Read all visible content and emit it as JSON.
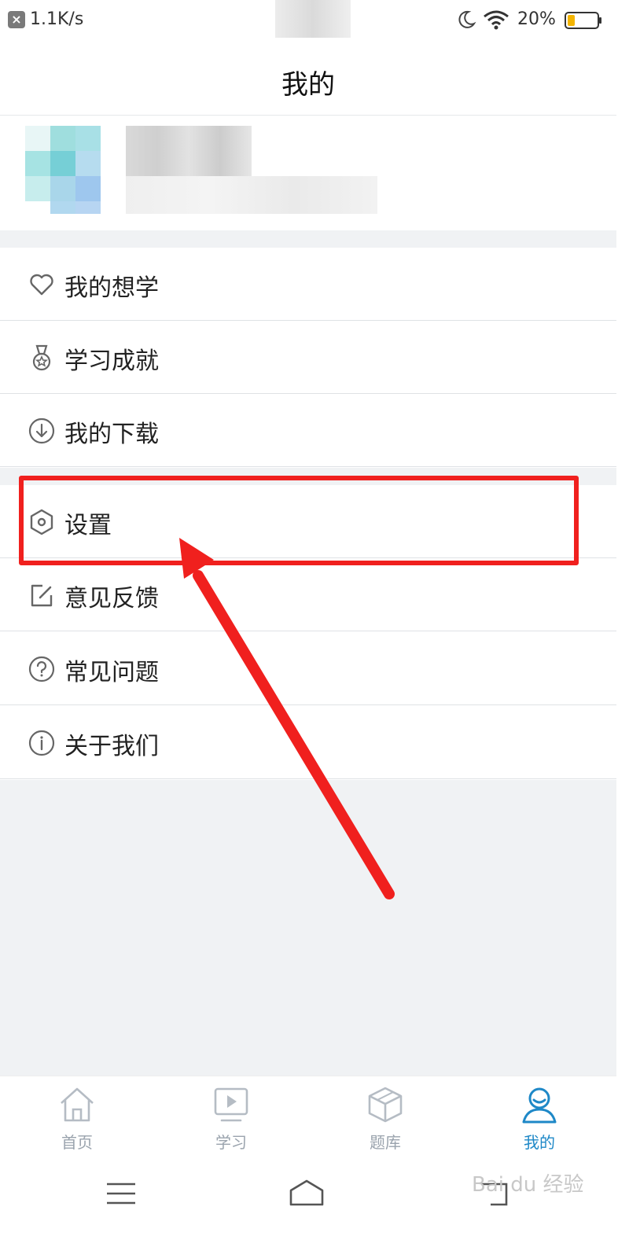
{
  "status_bar": {
    "net_speed": "1.1K/s",
    "battery_percent": "20%"
  },
  "header": {
    "title": "我的"
  },
  "menu": {
    "items": [
      {
        "label": "我的想学",
        "icon": "heart-icon"
      },
      {
        "label": "学习成就",
        "icon": "medal-icon"
      },
      {
        "label": "我的下载",
        "icon": "download-circle-icon"
      },
      {
        "label": "设置",
        "icon": "hexagon-settings-icon"
      },
      {
        "label": "意见反馈",
        "icon": "edit-feedback-icon"
      },
      {
        "label": "常见问题",
        "icon": "question-circle-icon"
      },
      {
        "label": "关于我们",
        "icon": "info-circle-icon"
      }
    ]
  },
  "tabbar": {
    "tabs": [
      {
        "label": "首页",
        "icon": "home-icon",
        "active": false
      },
      {
        "label": "学习",
        "icon": "play-screen-icon",
        "active": false
      },
      {
        "label": "题库",
        "icon": "cube-icon",
        "active": false
      },
      {
        "label": "我的",
        "icon": "user-icon",
        "active": true
      }
    ]
  },
  "colors": {
    "accent": "#1e88c7",
    "highlight": "#f0201e",
    "divider_bg": "#f0f2f4"
  }
}
